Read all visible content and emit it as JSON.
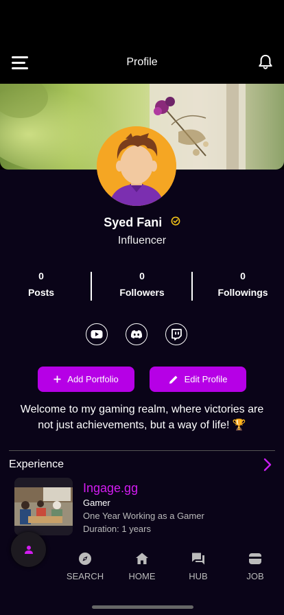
{
  "header": {
    "title": "Profile"
  },
  "profile": {
    "name": "Syed Fani",
    "role": "Influencer",
    "bio": "Welcome to my gaming realm, where victories are not just achievements, but a way of life! 🏆"
  },
  "stats": [
    {
      "value": "0",
      "label": "Posts"
    },
    {
      "value": "0",
      "label": "Followers"
    },
    {
      "value": "0",
      "label": "Followings"
    }
  ],
  "socials": [
    "youtube-icon",
    "discord-icon",
    "twitch-icon"
  ],
  "actions": {
    "add_portfolio": "Add Portfolio",
    "edit_profile": "Edit Profile"
  },
  "experience": {
    "title": "Experience",
    "items": [
      {
        "company": "Ingage.gg",
        "role": "Gamer",
        "description": "One Year Working as a Gamer",
        "duration": "Duration: 1 years"
      }
    ]
  },
  "nav": {
    "items": [
      {
        "label": "SEARCH",
        "icon": "compass-icon"
      },
      {
        "label": "HOME",
        "icon": "home-icon"
      },
      {
        "label": "HUB",
        "icon": "chat-icon"
      },
      {
        "label": "JOB",
        "icon": "wallet-icon"
      }
    ]
  },
  "colors": {
    "accent": "#b600e6",
    "company": "#d21cf0",
    "background": "#0a0418",
    "verified": "#f5c518",
    "avatar_bg": "#f5a623"
  }
}
